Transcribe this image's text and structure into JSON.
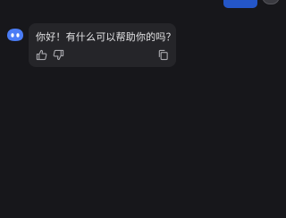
{
  "conversation": {
    "assistant_message": {
      "text": "你好！有什么可以帮助你的吗？",
      "actions": [
        "thumbs-up-icon",
        "thumbs-down-icon",
        "copy-icon"
      ]
    }
  },
  "colors": {
    "background": "#17171b",
    "bubble": "#252529",
    "user_bubble": "#2456c7",
    "bot_avatar": "#4a7cf5",
    "text": "#e6e6e8",
    "icon": "#a9a9ae"
  }
}
